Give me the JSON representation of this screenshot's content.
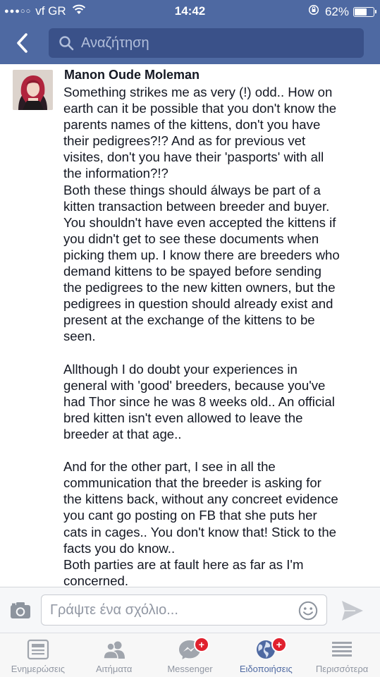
{
  "status_bar": {
    "signal": "●●●○○",
    "carrier": "vf GR",
    "time": "14:42",
    "battery_percent": "62%",
    "battery_level": 0.62
  },
  "nav": {
    "search_placeholder": "Αναζήτηση"
  },
  "comment": {
    "author": "Manon Oude Moleman",
    "lines": [
      "Something strikes me as very (!) odd..  How on",
      "earth can it be possible that you don't know the",
      "parents names of the kittens, don't you have",
      "their pedigrees?!? And as for previous vet",
      "visites, don't you have their 'pasports' with all",
      "the information?!?",
      "Both these things should álways be part of a",
      "kitten transaction between breeder and buyer.",
      "You shouldn't have even accepted the kittens if",
      "you didn't get to see these documents when",
      "picking them up. I know there are breeders who",
      "demand kittens to be spayed before sending",
      "the pedigrees to the new kitten owners, but the",
      "pedigrees in question should already exist and",
      "present at the exchange of the kittens to be",
      "seen.",
      "",
      "Allthough I do doubt your experiences in",
      "general with 'good' breeders, because you've",
      "had Thor since he was 8 weeks old.. An official",
      "bred kitten isn't even allowed to leave the",
      "breeder at that age..",
      "",
      "And for the other part, I see in all the",
      "communication that the breeder is asking for",
      "the kittens back, without any concreet evidence",
      "you cant go posting on FB that she puts her",
      "cats in cages.. You don't know that! Stick to the",
      "facts you do know..",
      "Both parties are at fault here as far as I'm",
      "concerned."
    ]
  },
  "composer": {
    "placeholder": "Γράψτε ένα σχόλιο..."
  },
  "tabs": [
    {
      "label": "Ενημερώσεις",
      "icon": "news-feed-icon",
      "active": false
    },
    {
      "label": "Αιτήματα",
      "icon": "friend-requests-icon",
      "active": false
    },
    {
      "label": "Messenger",
      "icon": "messenger-icon",
      "active": false,
      "badge": "+"
    },
    {
      "label": "Ειδοποιήσεις",
      "icon": "notifications-globe-icon",
      "active": true,
      "badge": "+"
    },
    {
      "label": "Περισσότερα",
      "icon": "more-menu-icon",
      "active": false
    }
  ],
  "colors": {
    "brand": "#4e69a2",
    "badge": "#e0212e"
  }
}
